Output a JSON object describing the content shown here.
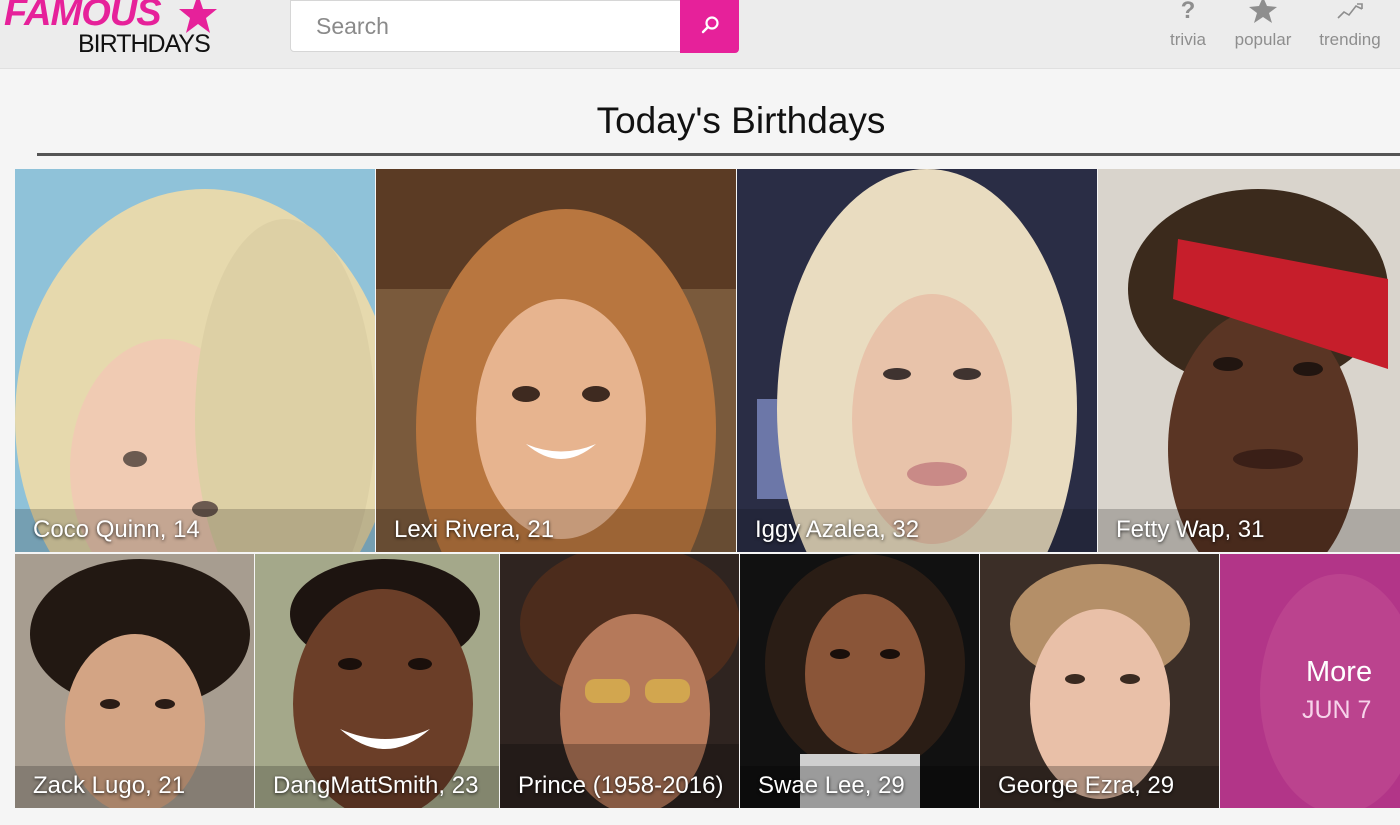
{
  "header": {
    "logo_top": "FAMOUS",
    "logo_bottom": "BIRTHDAYS",
    "search_placeholder": "Search",
    "nav": [
      {
        "label": "trivia",
        "icon": "question-icon"
      },
      {
        "label": "popular",
        "icon": "star-icon"
      },
      {
        "label": "trending",
        "icon": "trending-icon"
      }
    ]
  },
  "main": {
    "title": "Today's Birthdays",
    "celebrities_row1": [
      {
        "caption": "Coco Quinn, 14"
      },
      {
        "caption": "Lexi Rivera, 21"
      },
      {
        "caption": "Iggy Azalea, 32"
      },
      {
        "caption": "Fetty Wap, 31"
      }
    ],
    "celebrities_row2": [
      {
        "caption": "Zack Lugo, 21"
      },
      {
        "caption": "DangMattSmith, 23"
      },
      {
        "caption": "Prince (1958-2016)"
      },
      {
        "caption": "Swae Lee, 29"
      },
      {
        "caption": "George Ezra, 29"
      }
    ],
    "more": {
      "label": "More",
      "date": "JUN 7"
    }
  },
  "colors": {
    "brand_pink": "#e6219a",
    "header_bg": "#ececec",
    "page_bg": "#f5f5f5"
  }
}
